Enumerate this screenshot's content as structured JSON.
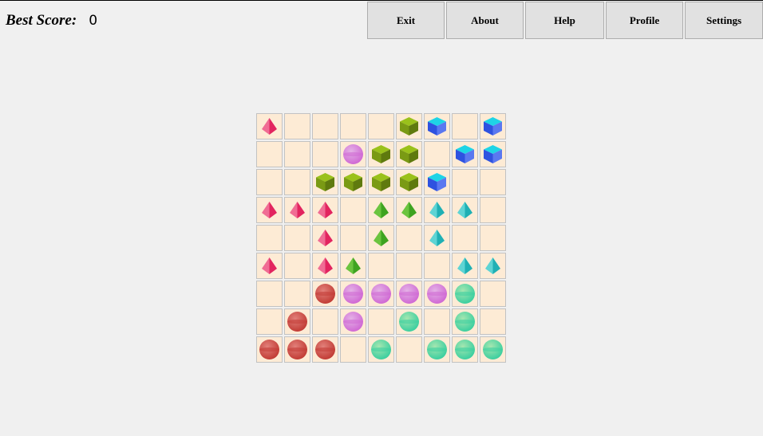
{
  "score": {
    "label": "Best Score:",
    "value": "0"
  },
  "menu": [
    {
      "name": "exit-button",
      "label": "Exit",
      "width": "97"
    },
    {
      "name": "about-button",
      "label": "About",
      "width": "97"
    },
    {
      "name": "help-button",
      "label": "Help",
      "width": "99"
    },
    {
      "name": "profile-button",
      "label": "Profile",
      "width": "97"
    },
    {
      "name": "settings-button",
      "label": "Settings",
      "width": "98"
    }
  ],
  "board": {
    "rows": 9,
    "cols": 9,
    "grid": [
      [
        "pink-pyramid",
        null,
        null,
        null,
        null,
        "olive-cube",
        "blue-cube",
        null,
        "blue-cube"
      ],
      [
        null,
        null,
        null,
        "violet-sphere",
        "olive-cube",
        "olive-cube",
        null,
        "blue-cube",
        "blue-cube"
      ],
      [
        null,
        null,
        "olive-cube",
        "olive-cube",
        "olive-cube",
        "olive-cube",
        "blue-cube",
        null,
        null
      ],
      [
        "pink-pyramid",
        "pink-pyramid",
        "pink-pyramid",
        null,
        "green-pyramid",
        "green-pyramid",
        "teal-pyramid",
        "teal-pyramid",
        null
      ],
      [
        null,
        null,
        "pink-pyramid",
        null,
        "green-pyramid",
        null,
        "teal-pyramid",
        null,
        null
      ],
      [
        "pink-pyramid",
        null,
        "pink-pyramid",
        "green-pyramid",
        null,
        null,
        null,
        "teal-pyramid",
        "teal-pyramid"
      ],
      [
        null,
        null,
        "red-sphere",
        "violet-sphere",
        "violet-sphere",
        "violet-sphere",
        "violet-sphere",
        "mint-sphere",
        null
      ],
      [
        null,
        "red-sphere",
        null,
        "violet-sphere",
        null,
        "mint-sphere",
        null,
        "mint-sphere",
        null
      ],
      [
        "red-sphere",
        "red-sphere",
        "red-sphere",
        null,
        "mint-sphere",
        null,
        "mint-sphere",
        "mint-sphere",
        "mint-sphere"
      ]
    ]
  },
  "colors": {
    "cell_bg": "#fdebd5",
    "cell_border": "#c2c2c2",
    "page_bg": "#f0f0f0",
    "pink-pyramid": [
      "#f06c94",
      "#e2245f"
    ],
    "green-pyramid": [
      "#6bc43f",
      "#3ea320"
    ],
    "teal-pyramid": [
      "#5ed4d4",
      "#1fb0b4"
    ],
    "olive-cube": [
      "#9ac11b",
      "#7a9a14",
      "#5f7a0e"
    ],
    "blue-cube": [
      "#1ed4e6",
      "#2e52e0",
      "#5a78f0"
    ],
    "red-sphere": [
      "#e2807a",
      "#c23d36"
    ],
    "violet-sphere": [
      "#e4b2e6",
      "#d06ad4"
    ],
    "mint-sphere": [
      "#a5e6b0",
      "#3dcfa0"
    ]
  }
}
